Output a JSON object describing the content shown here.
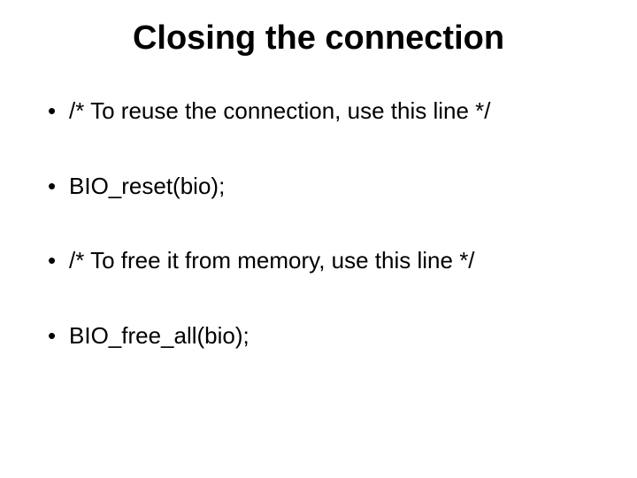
{
  "title": "Closing the connection",
  "bullets": [
    "/* To reuse the connection, use this line */",
    "BIO_reset(bio);",
    "/* To free it from memory, use this line */",
    "BIO_free_all(bio);"
  ]
}
